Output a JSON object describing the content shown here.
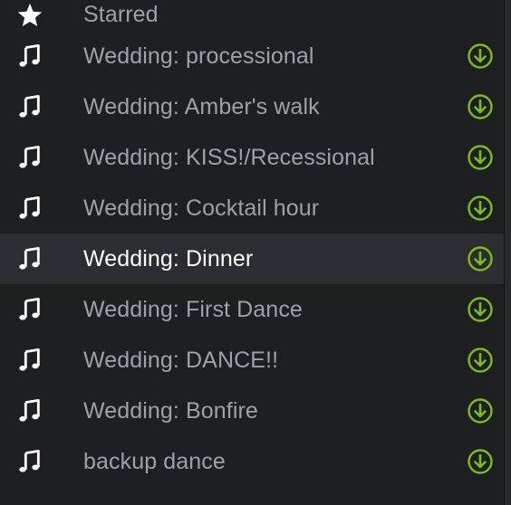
{
  "colors": {
    "background": "#1e1f21",
    "active_row": "#2c2d30",
    "label": "#a0a1a4",
    "label_active": "#ffffff",
    "download_accent": "#7dbb1f"
  },
  "playlists": {
    "starred": {
      "label": "Starred",
      "icon": "star-icon"
    },
    "items": [
      {
        "label": "Wedding: processional",
        "icon": "music-note-icon",
        "download_icon": "download-icon"
      },
      {
        "label": "Wedding: Amber's walk",
        "icon": "music-note-icon",
        "download_icon": "download-icon"
      },
      {
        "label": "Wedding: KISS!/Recessional",
        "icon": "music-note-icon",
        "download_icon": "download-icon"
      },
      {
        "label": "Wedding: Cocktail hour",
        "icon": "music-note-icon",
        "download_icon": "download-icon"
      },
      {
        "label": "Wedding: Dinner",
        "icon": "music-note-icon",
        "download_icon": "download-icon",
        "selected": true
      },
      {
        "label": "Wedding: First Dance",
        "icon": "music-note-icon",
        "download_icon": "download-icon"
      },
      {
        "label": "Wedding: DANCE!!",
        "icon": "music-note-icon",
        "download_icon": "download-icon"
      },
      {
        "label": "Wedding: Bonfire",
        "icon": "music-note-icon",
        "download_icon": "download-icon"
      },
      {
        "label": "backup dance",
        "icon": "music-note-icon",
        "download_icon": "download-icon"
      }
    ]
  }
}
